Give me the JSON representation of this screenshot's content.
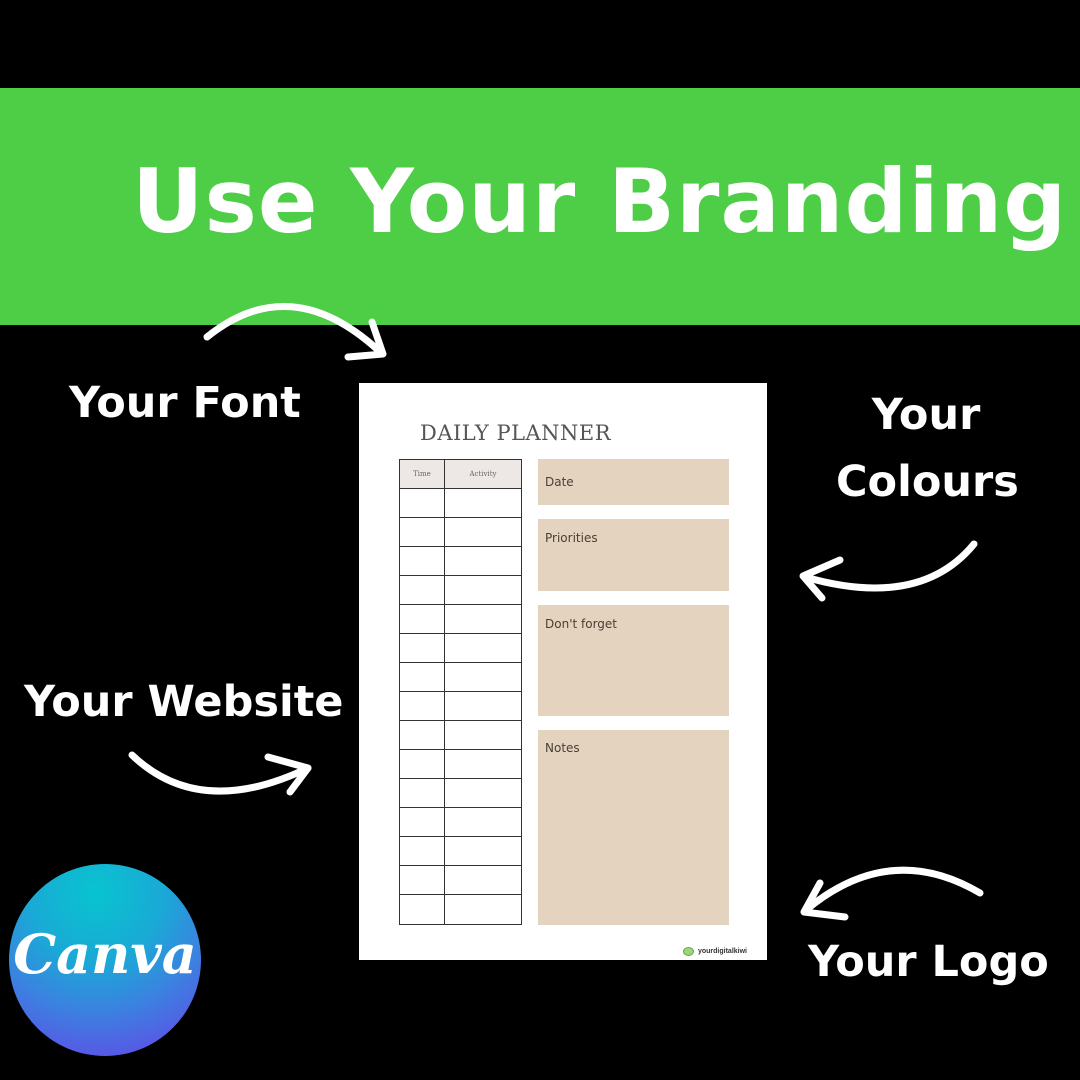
{
  "banner": {
    "title": "Use Your Branding",
    "color": "#4ecd47"
  },
  "labels": {
    "font": "Your Font",
    "colours_line1": "Your",
    "colours_line2": "Colours",
    "website": "Your Website",
    "logo": "Your Logo"
  },
  "planner": {
    "title": "DAILY PLANNER",
    "table": {
      "headers": [
        "Time",
        "Activity"
      ],
      "row_count": 15
    },
    "boxes": [
      "Date",
      "Priorities",
      "Don't forget",
      "Notes"
    ],
    "box_color": "#e4d3bf",
    "footer_brand": "yourdigitalkiwi"
  },
  "canva": {
    "word": "Canva"
  }
}
